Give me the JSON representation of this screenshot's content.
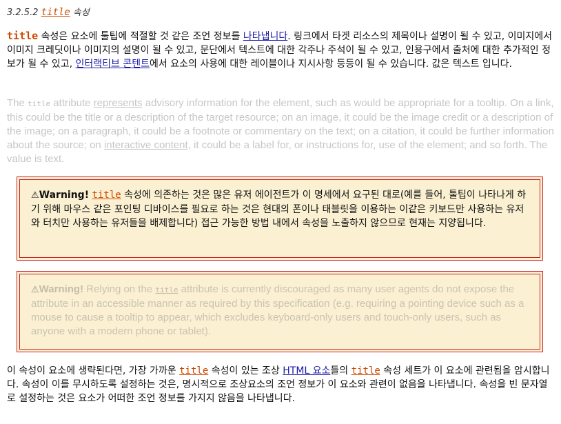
{
  "heading": {
    "number": "3.2.5.2",
    "code": "title",
    "suffix": "속성"
  },
  "para1": {
    "kw": "title",
    "t1": " 속성은 요소에 툴팁에 적절할 것 같은 조언 정보를 ",
    "link1": "나타냅니다",
    "t2": ". 링크에서 타겟 리소스의 제목이나 설명이 될 수 있고, 이미지에서 이미지 크레딧이나 이미지의 설명이 될 수 있고, 문단에서 텍스트에 대한 각주나 주석이 될 수 있고, 인용구에서 출처에 대한 추가적인 정보가 될 수 있고, ",
    "link2": "인터랙티브 콘텐트",
    "t3": "에서 요소의 사용에 대한 레이블이나 지시사항 등등이 될 수 있습니다. 값은 텍스트 입니다."
  },
  "para2": {
    "t0": "The ",
    "kw": "title",
    "t1": " attribute ",
    "link1": "represents",
    "t2": " advisory information for the element, such as would be appropriate for a tooltip. On a link, this could be the title or a description of the target resource; on an image, it could be the image credit or a description of the image; on a paragraph, it could be a footnote or commentary on the text; on a citation, it could be further information about the source; on ",
    "link2": "interactive content",
    "t3": ", it could be a label for, or instructions for, use of the element; and so forth. The value is text."
  },
  "warning1": {
    "icon": "⚠",
    "label": "Warning!",
    "kw": "title",
    "text": " 속성에 의존하는 것은 많은 유저 에이전트가 이 명세에서 요구된 대로(예를 들어, 툴팁이 나타나게 하기 위해 마우스 같은 포인팅 디바이스를 필요로 하는 것은 현대의 폰이나 태블릿을 이용하는 이같은 키보드만 사용하는 유저와 터치만 사용하는 유저들을 배제합니다) 접근 가능한 방법 내에서 속성을 노출하지 않으므로 현재는 지양됩니다."
  },
  "warning2": {
    "icon": "⚠",
    "label": "Warning!",
    "t1": " Relying on the ",
    "kw": "title",
    "t2": " attribute is currently discouraged as many user agents do not expose the attribute in an accessible manner as required by this specification (e.g. requiring a pointing device such as a mouse to cause a tooltip to appear, which excludes keyboard-only users and touch-only users, such as anyone with a modern phone or tablet)."
  },
  "para3": {
    "t1": "이 속성이 요소에 생략된다면, 가장 가까운 ",
    "kw1": "title",
    "t2": " 속성이 있는 조상 ",
    "link1": "HTML 요소",
    "t3": "들의 ",
    "kw2": "title",
    "t4": " 속성 세트가 이 요소에 관련됨을 암시합니다. 속성이 이를 무시하도록 설정하는 것은, 명시적으로 조상요소의 조언 정보가 이 요소와 관련이 없음을 나타냅니다. 속성을 빈 문자열로 설정하는 것은 요소가 어떠한 조언 정보를 가지지 않음을 나타냅니다."
  },
  "colors": {
    "code": "#cc4a00",
    "link": "#1a1aa6",
    "warning_bg": "#fbf0d2",
    "warning_border": "#cc2222"
  }
}
